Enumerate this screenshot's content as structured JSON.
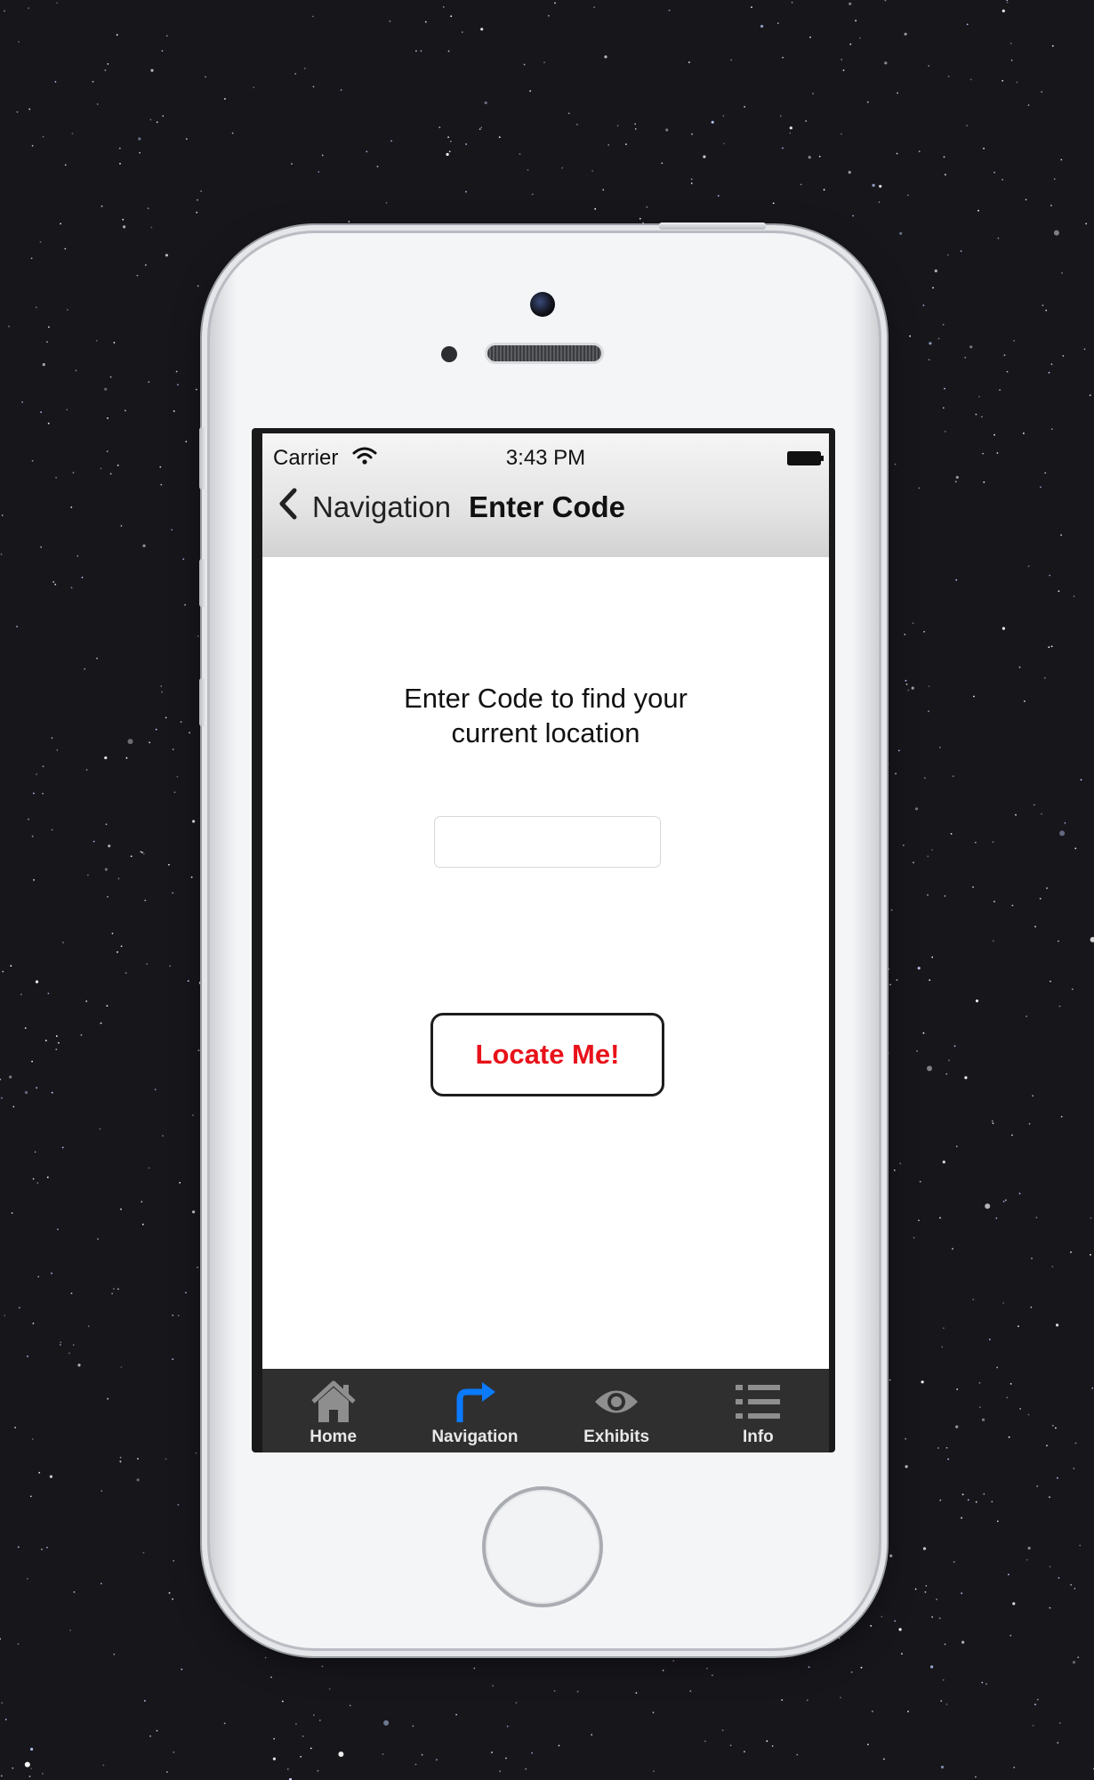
{
  "status_bar": {
    "carrier": "Carrier",
    "time": "3:43 PM"
  },
  "nav_bar": {
    "back_label": "Navigation",
    "title": "Enter Code"
  },
  "content": {
    "prompt_line1": "Enter Code to find your",
    "prompt_line2": "current location",
    "code_input": {
      "value": "",
      "placeholder": ""
    },
    "locate_button": "Locate Me!"
  },
  "tab_bar": {
    "selected": "Navigation",
    "items": [
      {
        "label": "Home",
        "icon": "home-icon"
      },
      {
        "label": "Navigation",
        "icon": "turn-right-arrow-icon"
      },
      {
        "label": "Exhibits",
        "icon": "eye-icon"
      },
      {
        "label": "Info",
        "icon": "list-icon"
      }
    ]
  },
  "colors": {
    "accent": "#0a7aff",
    "button_text": "#e8121a",
    "tab_bar_bg": "#2f2f2f",
    "tab_icon_inactive": "#8e8e8e"
  }
}
